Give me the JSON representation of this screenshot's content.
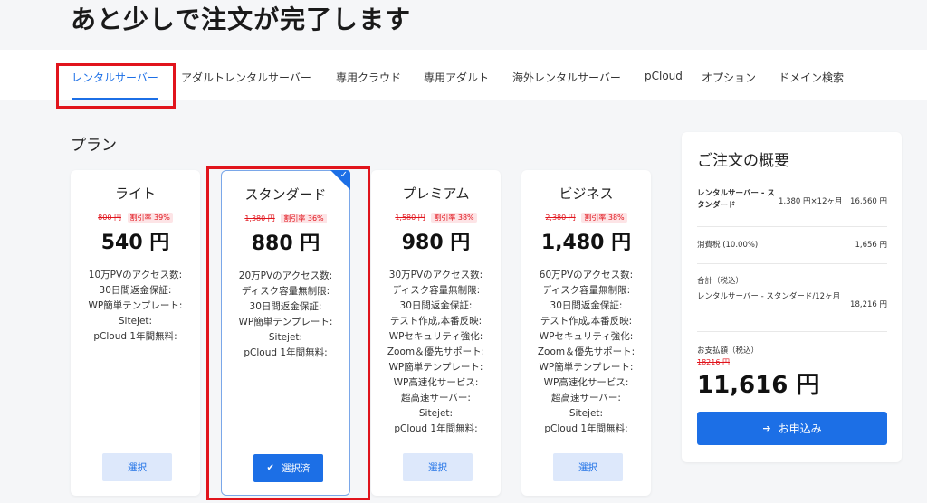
{
  "page_title": "あと少しで注文が完了します",
  "tabs": [
    {
      "label": "レンタルサーバー",
      "active": true
    },
    {
      "label": "アダルトレンタルサーバー"
    },
    {
      "label": "専用クラウド"
    },
    {
      "label": "専用アダルト"
    },
    {
      "label": "海外レンタルサーバー"
    },
    {
      "label": "pCloud"
    },
    {
      "label": "オプション"
    },
    {
      "label": "ドメイン検索"
    }
  ],
  "plan_section_title": "プラン",
  "plans": [
    {
      "name": "ライト",
      "old_price": "800 円",
      "discount": "割引率 39%",
      "price": "540 円",
      "features": [
        "10万PVのアクセス数:",
        "30日間返金保証:",
        "WP簡単テンプレート:",
        "Sitejet:",
        "pCloud 1年間無料:"
      ],
      "button": "選択"
    },
    {
      "name": "スタンダード",
      "old_price": "1,380 円",
      "discount": "割引率 36%",
      "price": "880 円",
      "features": [
        "20万PVのアクセス数:",
        "ディスク容量無制限:",
        "30日間返金保証:",
        "WP簡単テンプレート:",
        "Sitejet:",
        "pCloud 1年間無料:"
      ],
      "button": "選択済",
      "selected": true
    },
    {
      "name": "プレミアム",
      "old_price": "1,580 円",
      "discount": "割引率 38%",
      "price": "980 円",
      "features": [
        "30万PVのアクセス数:",
        "ディスク容量無制限:",
        "30日間返金保証:",
        "テスト作成,本番反映:",
        "WPセキュリティ強化:",
        "Zoom＆優先サポート:",
        "WP簡単テンプレート:",
        "WP高速化サービス:",
        "超高速サーバー:",
        "Sitejet:",
        "pCloud 1年間無料:"
      ],
      "button": "選択"
    },
    {
      "name": "ビジネス",
      "old_price": "2,380 円",
      "discount": "割引率 38%",
      "price": "1,480 円",
      "features": [
        "60万PVのアクセス数:",
        "ディスク容量無制限:",
        "30日間返金保証:",
        "テスト作成,本番反映:",
        "WPセキュリティ強化:",
        "Zoom＆優先サポート:",
        "WP簡単テンプレート:",
        "WP高速化サービス:",
        "超高速サーバー:",
        "Sitejet:",
        "pCloud 1年間無料:"
      ],
      "button": "選択"
    }
  ],
  "summary": {
    "title": "ご注文の概要",
    "item_name": "レンタルサーバー - スタンダード",
    "item_unit": "1,380 円×12ヶ月",
    "item_amount": "16,560 円",
    "tax_label": "消費税 (10.00%)",
    "tax_amount": "1,656 円",
    "total_label": "合計（税込）",
    "total_item": "レンタルサーバー - スタンダード/12ヶ月",
    "total_amount": "18,216 円",
    "pay_label": "お支払額（税込）",
    "pay_old": "18216 円",
    "pay_total": "11,616 円",
    "apply_button": "お申込み"
  },
  "colors": {
    "accent": "#1c6fe6",
    "highlight_border": "#e1141c",
    "discount_text": "#e1141c",
    "discount_bg": "#fde4e6"
  }
}
